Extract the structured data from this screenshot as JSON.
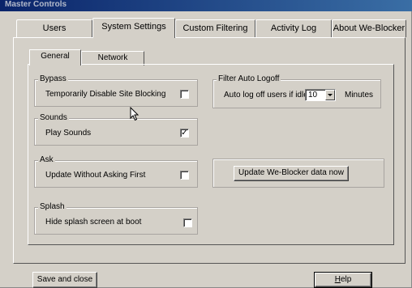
{
  "window": {
    "title": "Master Controls"
  },
  "tabs": [
    {
      "label": "Users"
    },
    {
      "label": "System Settings"
    },
    {
      "label": "Custom Filtering"
    },
    {
      "label": "Activity Log"
    },
    {
      "label": "About We-Blocker"
    }
  ],
  "subtabs": [
    {
      "label": "General"
    },
    {
      "label": "Network"
    }
  ],
  "bypass": {
    "legend": "Bypass",
    "option_label": "Temporarily Disable Site Blocking",
    "checked": "false"
  },
  "sounds": {
    "legend": "Sounds",
    "option_label": "Play Sounds",
    "checked": "true",
    "checkmark": "✓"
  },
  "ask": {
    "legend": "Ask",
    "option_label": "Update Without Asking First",
    "checked": "false"
  },
  "splash": {
    "legend": "Splash",
    "option_label": "Hide splash screen at boot",
    "checked": "false"
  },
  "filter_logoff": {
    "legend": "Filter Auto Logoff",
    "label": "Auto log off users if idle",
    "value": "10",
    "unit": "Minutes"
  },
  "update": {
    "button_label": "Update We-Blocker data now"
  },
  "footer": {
    "save_label": "Save and close",
    "help_label": "Help"
  },
  "icons": {
    "cursor": "mouse-pointer-icon",
    "dropdown": "chevron-down-icon"
  }
}
